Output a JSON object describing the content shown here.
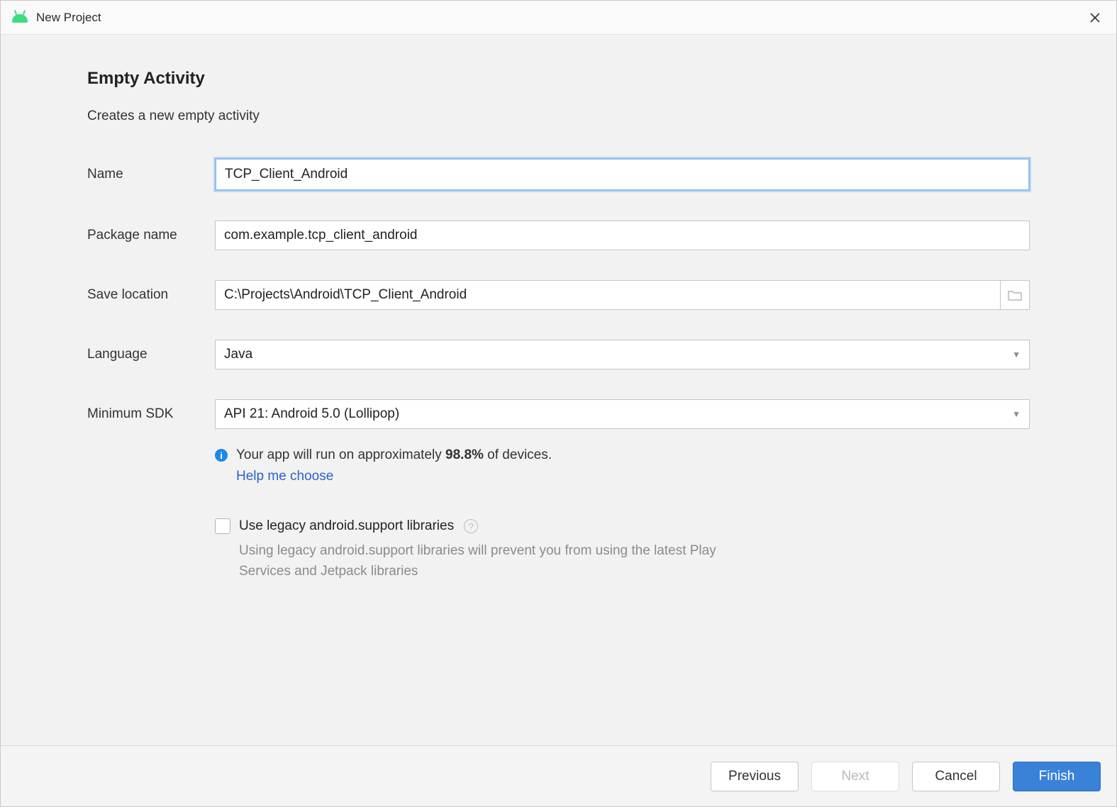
{
  "window": {
    "title": "New Project"
  },
  "page": {
    "heading": "Empty Activity",
    "description": "Creates a new empty activity"
  },
  "form": {
    "name_label": "Name",
    "name_value": "TCP_Client_Android",
    "package_label": "Package name",
    "package_value": "com.example.tcp_client_android",
    "location_label": "Save location",
    "location_value": "C:\\Projects\\Android\\TCP_Client_Android",
    "language_label": "Language",
    "language_value": "Java",
    "min_sdk_label": "Minimum SDK",
    "min_sdk_value": "API 21: Android 5.0 (Lollipop)"
  },
  "info": {
    "prefix": "Your app will run on approximately ",
    "percent": "98.8%",
    "suffix": " of devices.",
    "help_link": "Help me choose"
  },
  "legacy": {
    "checkbox_label": "Use legacy android.support libraries",
    "description": "Using legacy android.support libraries will prevent you from using the latest Play Services and Jetpack libraries"
  },
  "footer": {
    "previous": "Previous",
    "next": "Next",
    "cancel": "Cancel",
    "finish": "Finish"
  }
}
